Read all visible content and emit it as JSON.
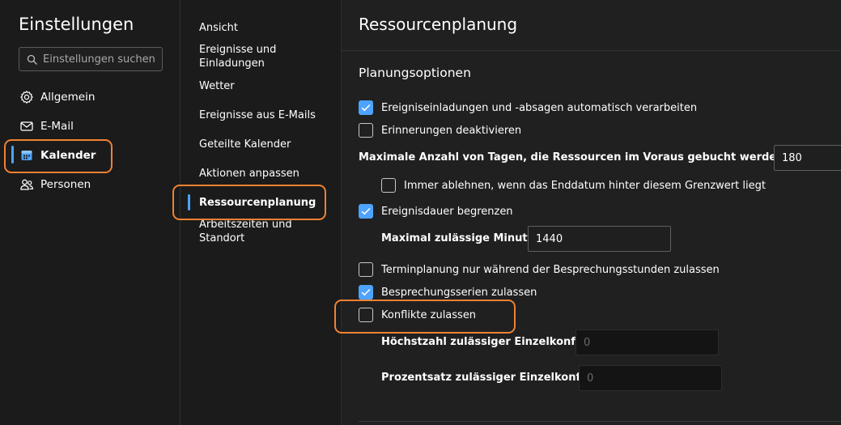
{
  "settings": {
    "title": "Einstellungen",
    "search_placeholder": "Einstellungen suchen",
    "nav": [
      {
        "label": "Allgemein",
        "icon": "gear-icon"
      },
      {
        "label": "E-Mail",
        "icon": "mail-icon"
      },
      {
        "label": "Kalender",
        "icon": "calendar-icon",
        "selected": true
      },
      {
        "label": "Personen",
        "icon": "people-icon"
      }
    ]
  },
  "calendar_menu": {
    "items": [
      {
        "label": "Ansicht"
      },
      {
        "label": "Ereignisse und Einladungen"
      },
      {
        "label": "Wetter"
      },
      {
        "label": "Ereignisse aus E-Mails"
      },
      {
        "label": "Geteilte Kalender"
      },
      {
        "label": "Aktionen anpassen"
      },
      {
        "label": "Ressourcenplanung",
        "selected": true
      },
      {
        "label": "Arbeitszeiten und Standort"
      }
    ]
  },
  "main": {
    "title": "Ressourcenplanung",
    "section": "Planungsoptionen",
    "options": {
      "auto_process": {
        "label": "Ereigniseinladungen und -absagen automatisch verarbeiten",
        "checked": true
      },
      "disable_reminders": {
        "label": "Erinnerungen deaktivieren",
        "checked": false
      },
      "max_days": {
        "label": "Maximale Anzahl von Tagen, die Ressourcen im Voraus gebucht werden können",
        "value": "180"
      },
      "always_decline": {
        "label": "Immer ablehnen, wenn das Enddatum hinter diesem Grenzwert liegt",
        "checked": false
      },
      "limit_duration": {
        "label": "Ereignisdauer begrenzen",
        "checked": true
      },
      "max_minutes": {
        "label": "Maximal zulässige Minuten",
        "value": "1440"
      },
      "working_hours_only": {
        "label": "Terminplanung nur während der Besprechungsstunden zulassen",
        "checked": false
      },
      "allow_series": {
        "label": "Besprechungsserien zulassen",
        "checked": true
      },
      "allow_conflicts": {
        "label": "Konflikte zulassen",
        "checked": false
      },
      "max_conflicts": {
        "label": "Höchstzahl zulässiger Einzelkonflikte",
        "value": "0"
      },
      "pct_conflicts": {
        "label": "Prozentsatz zulässiger Einzelkonflikte",
        "value": "0"
      }
    }
  },
  "colors": {
    "accent": "#4da3ff",
    "highlight": "#ef8233",
    "background": "#1f1f1f"
  }
}
